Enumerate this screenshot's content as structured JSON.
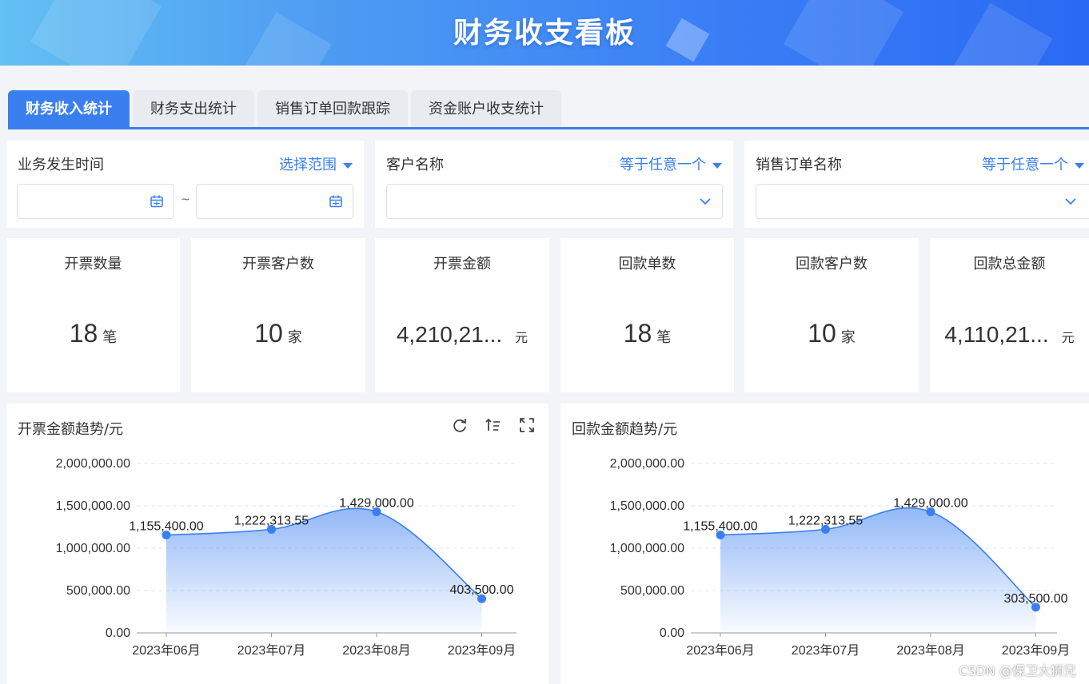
{
  "banner": {
    "title": "财务收支看板"
  },
  "tabs": [
    {
      "label": "财务收入统计",
      "active": true
    },
    {
      "label": "财务支出统计",
      "active": false
    },
    {
      "label": "销售订单回款跟踪",
      "active": false
    },
    {
      "label": "资金账户收支统计",
      "active": false
    }
  ],
  "filters": {
    "date": {
      "label": "业务发生时间",
      "mode": "选择范围",
      "separator": "~"
    },
    "customer": {
      "label": "客户名称",
      "mode": "等于任意一个"
    },
    "order": {
      "label": "销售订单名称",
      "mode": "等于任意一个"
    }
  },
  "kpis": [
    {
      "title": "开票数量",
      "value": "18",
      "unit": "笔"
    },
    {
      "title": "开票客户数",
      "value": "10",
      "unit": "家"
    },
    {
      "title": "开票金额",
      "value": "4,210,21...",
      "unit": "元"
    },
    {
      "title": "回款单数",
      "value": "18",
      "unit": "笔"
    },
    {
      "title": "回款客户数",
      "value": "10",
      "unit": "家"
    },
    {
      "title": "回款总金额",
      "value": "4,110,21...",
      "unit": "元"
    }
  ],
  "panels": {
    "invoice": {
      "title": "开票金额趋势/元"
    },
    "payment": {
      "title": "回款金额趋势/元"
    }
  },
  "chart_data": [
    {
      "type": "area",
      "title": "开票金额趋势/元",
      "categories": [
        "2023年06月",
        "2023年07月",
        "2023年08月",
        "2023年09月"
      ],
      "values": [
        1155400.0,
        1222313.55,
        1429000.0,
        403500.0
      ],
      "labels": [
        "1,155,400.00",
        "1,222,313.55",
        "1,429,000.00",
        "403,500.00"
      ],
      "ylim": [
        0,
        2000000
      ],
      "yticks": [
        "0.00",
        "500,000.00",
        "1,000,000.00",
        "1,500,000.00",
        "2,000,000.00"
      ],
      "grid": true,
      "color": "#3a7ff0"
    },
    {
      "type": "area",
      "title": "回款金额趋势/元",
      "categories": [
        "2023年06月",
        "2023年07月",
        "2023年08月",
        "2023年09月"
      ],
      "values": [
        1155400.0,
        1222313.55,
        1429000.0,
        303500.0
      ],
      "labels": [
        "1,155,400.00",
        "1,222,313.55",
        "1,429,000.00",
        "303,500.00"
      ],
      "ylim": [
        0,
        2000000
      ],
      "yticks": [
        "0.00",
        "500,000.00",
        "1,000,000.00",
        "1,500,000.00",
        "2,000,000.00"
      ],
      "grid": true,
      "color": "#3a7ff0"
    }
  ],
  "watermark": "CSDN @保卫大狮兄"
}
